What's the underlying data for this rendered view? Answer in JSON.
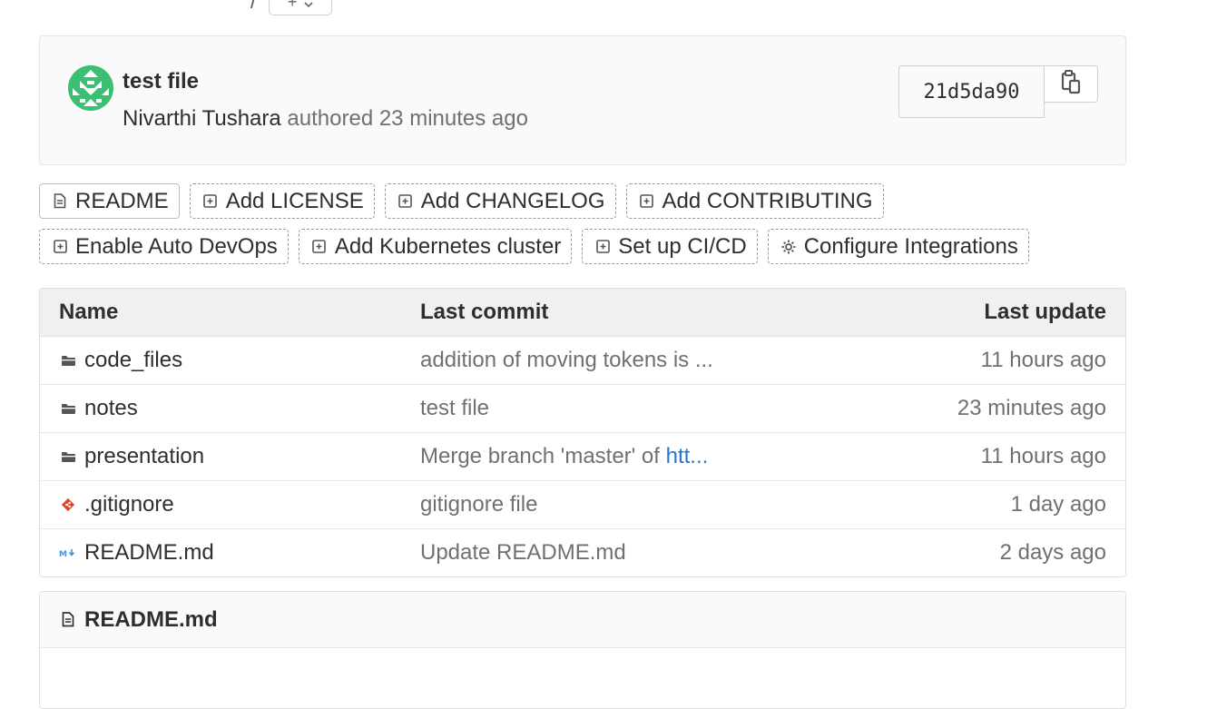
{
  "breadcrumb": {
    "separator": "/",
    "add_button_label": "+"
  },
  "commit": {
    "title": "test file",
    "author": "Nivarthi Tushara",
    "meta_text": "authored 23 minutes ago",
    "sha": "21d5da90",
    "copy_icon": "clipboard-icon"
  },
  "shortcuts": {
    "row1": [
      {
        "label": "README",
        "icon": "file-icon"
      },
      {
        "label": "Add LICENSE",
        "icon": "plus-square-icon"
      },
      {
        "label": "Add CHANGELOG",
        "icon": "plus-square-icon"
      },
      {
        "label": "Add CONTRIBUTING",
        "icon": "plus-square-icon"
      }
    ],
    "row2": [
      {
        "label": "Enable Auto DevOps",
        "icon": "plus-square-icon"
      },
      {
        "label": "Add Kubernetes cluster",
        "icon": "plus-square-icon"
      },
      {
        "label": "Set up CI/CD",
        "icon": "plus-square-icon"
      },
      {
        "label": "Configure Integrations",
        "icon": "gear-icon"
      }
    ]
  },
  "file_tree": {
    "headers": {
      "name": "Name",
      "last_commit": "Last commit",
      "last_update": "Last update"
    },
    "rows": [
      {
        "name": "code_files",
        "icon": "folder-icon",
        "commit": "addition of moving tokens is ...",
        "commit_link": "",
        "update": "11 hours ago"
      },
      {
        "name": "notes",
        "icon": "folder-icon",
        "commit": "test file",
        "commit_link": "",
        "update": "23 minutes ago"
      },
      {
        "name": "presentation",
        "icon": "folder-icon",
        "commit": "Merge branch 'master' of ",
        "commit_link": "htt...",
        "update": "11 hours ago"
      },
      {
        "name": ".gitignore",
        "icon": "git-icon",
        "commit": "gitignore file",
        "commit_link": "",
        "update": "1 day ago"
      },
      {
        "name": "README.md",
        "icon": "markdown-icon",
        "commit": "Update README.md",
        "commit_link": "",
        "update": "2 days ago"
      }
    ]
  },
  "readme": {
    "title": "README.md",
    "icon": "file-icon"
  },
  "colors": {
    "link": "#1f78d1",
    "muted": "#707070",
    "text": "#2e2e2e",
    "avatar": "#3bbf73",
    "git": "#e24329"
  }
}
